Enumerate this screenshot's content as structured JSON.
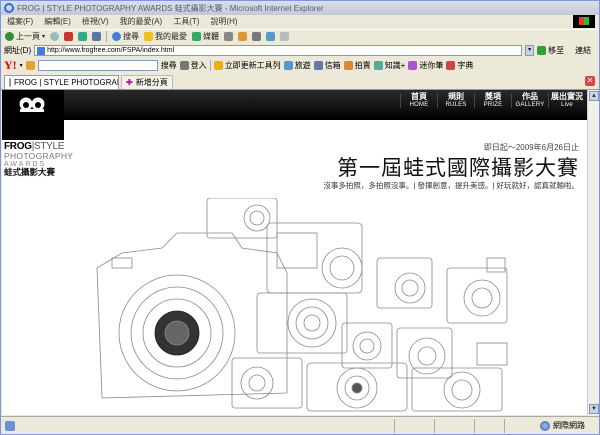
{
  "window": {
    "title": "FROG | STYLE PHOTOGRAPHY AWARDS 蛙式攝影大賽 - Microsoft Internet Explorer"
  },
  "menu": [
    "檔案(F)",
    "編輯(E)",
    "檢視(V)",
    "我的最愛(A)",
    "工具(T)",
    "說明(H)"
  ],
  "toolbar": {
    "back": "上一頁",
    "search": "搜尋",
    "favorites": "我的最愛",
    "media": "媒體"
  },
  "address": {
    "label": "網址(D)",
    "url": "http://www.frogfree.com/FSPA/index.html",
    "go": "移至",
    "links": "連結"
  },
  "yahoo": {
    "search_btn": "搜尋",
    "login": "登入",
    "update": "立即更新工具列",
    "travel": "旅遊",
    "mail": "信箱",
    "auction": "拍賣",
    "knowledge": "知識+",
    "mini": "迷你筆",
    "dict": "字典"
  },
  "tabs": {
    "active": "FROG | STYLE PHOTOGRAPH...",
    "new_tab": "新增分頁"
  },
  "site": {
    "brand": {
      "line1_bold": "FROG",
      "line1_thin": "STYLE",
      "line2": "PHOTOGRAPHY",
      "line3": "AWARDS",
      "line4": "蛙式攝影大賽"
    },
    "nav": [
      {
        "zh": "首頁",
        "en": "HOME"
      },
      {
        "zh": "規則",
        "en": "RULES"
      },
      {
        "zh": "獎項",
        "en": "PRIZE"
      },
      {
        "zh": "作品",
        "en": "GALLERY"
      },
      {
        "zh": "展出實況",
        "en": "Live"
      }
    ],
    "date_range": "即日起～2009年6月26日止",
    "headline": "第一屆蛙式國際攝影大賽",
    "slogan": "沒事多拍照，多拍照沒事。| 發揮創意，提升美感。| 好玩就好，認真就輸啦。"
  },
  "status": {
    "zone": "網際網路"
  }
}
